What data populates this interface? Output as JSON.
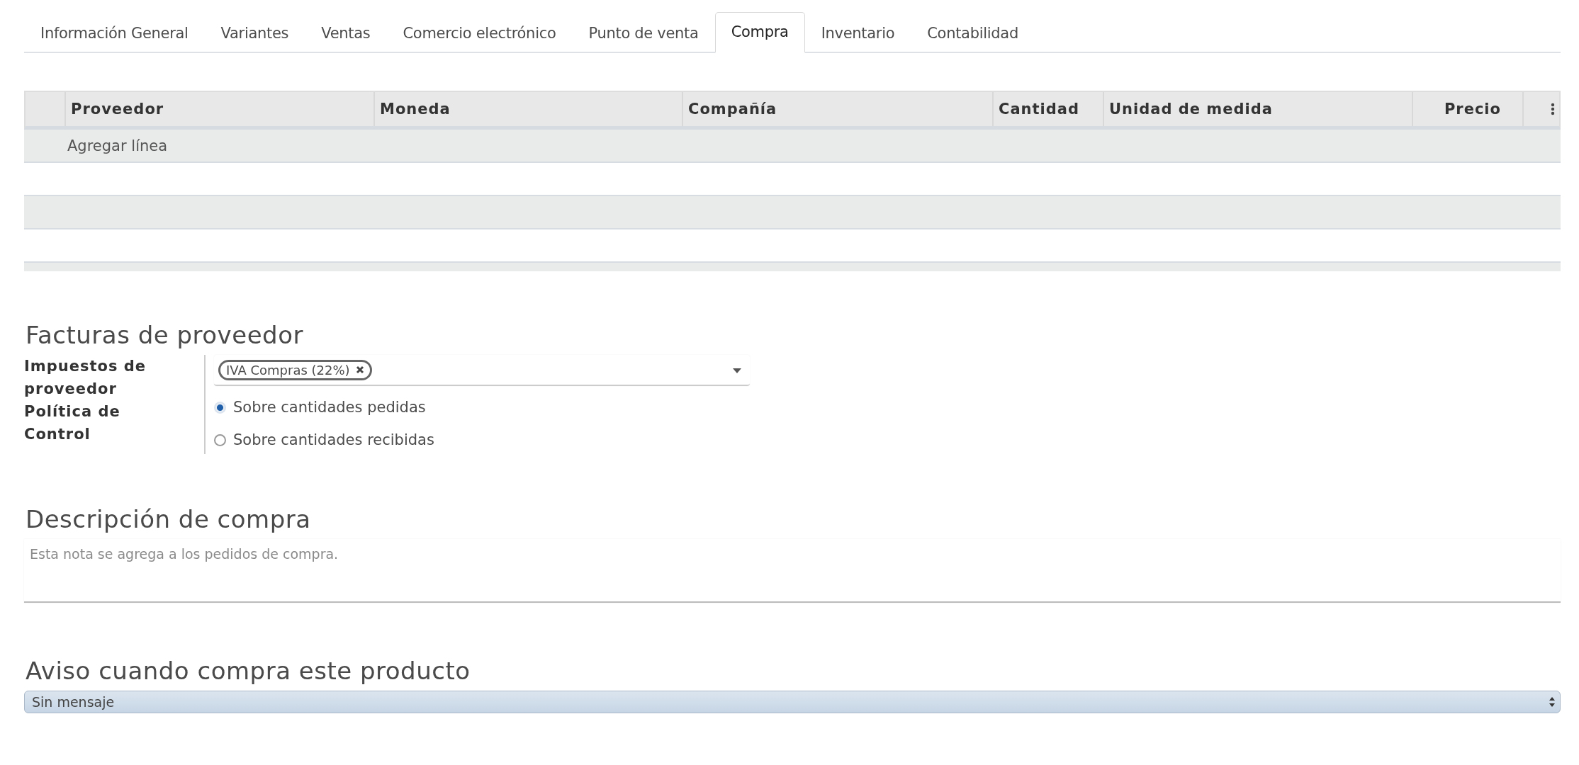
{
  "tabs": [
    {
      "label": "Información General",
      "selected": false
    },
    {
      "label": "Variantes",
      "selected": false
    },
    {
      "label": "Ventas",
      "selected": false
    },
    {
      "label": "Comercio electrónico",
      "selected": false
    },
    {
      "label": "Punto de venta",
      "selected": false
    },
    {
      "label": "Compra",
      "selected": true
    },
    {
      "label": "Inventario",
      "selected": false
    },
    {
      "label": "Contabilidad",
      "selected": false
    }
  ],
  "table": {
    "columns": [
      {
        "label": "Proveedor"
      },
      {
        "label": "Moneda"
      },
      {
        "label": "Compañía"
      },
      {
        "label": "Cantidad"
      },
      {
        "label": "Unidad de medida"
      },
      {
        "label": "Precio"
      }
    ],
    "add_line": "Agregar línea"
  },
  "vendor_bills": {
    "title": "Facturas de proveedor",
    "taxes_label": "Impuestos de proveedor",
    "taxes": [
      {
        "label": "IVA Compras (22%)"
      }
    ],
    "policy_label": "Política de Control",
    "policy_options": [
      {
        "label": "Sobre cantidades pedidas",
        "selected": true
      },
      {
        "label": "Sobre cantidades recibidas",
        "selected": false
      }
    ]
  },
  "purchase_description": {
    "title": "Descripción de compra",
    "placeholder": "Esta nota se agrega a los pedidos de compra."
  },
  "purchase_warning": {
    "title": "Aviso cuando compra este producto",
    "value": "Sin mensaje"
  }
}
